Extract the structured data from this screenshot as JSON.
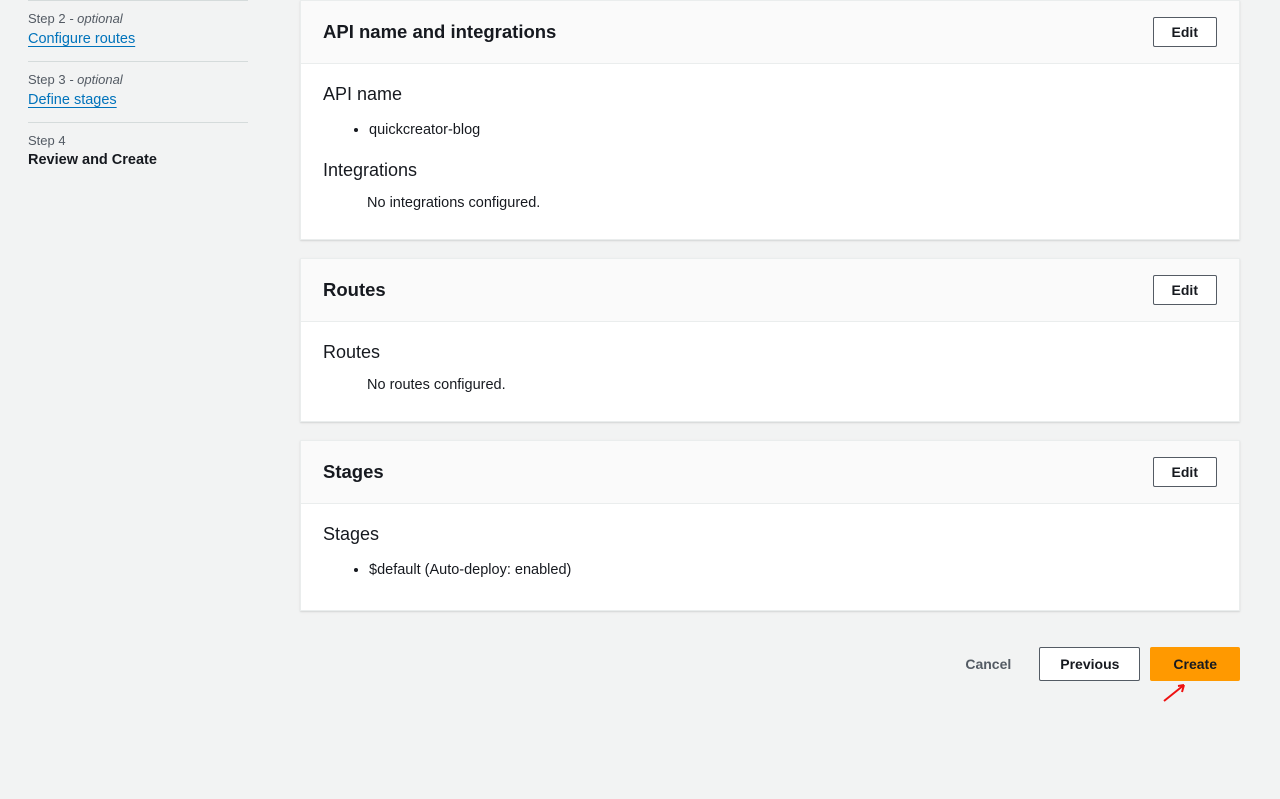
{
  "sidebar": {
    "steps": [
      {
        "meta": "Step 2",
        "optional": "- optional",
        "label": "Configure routes",
        "link": true
      },
      {
        "meta": "Step 3",
        "optional": "- optional",
        "label": "Define stages",
        "link": true
      },
      {
        "meta": "Step 4",
        "optional": "",
        "label": "Review and Create",
        "link": false
      }
    ]
  },
  "cards": {
    "api": {
      "title": "API name and integrations",
      "edit": "Edit",
      "name_heading": "API name",
      "name_value": "quickcreator-blog",
      "integrations_heading": "Integrations",
      "integrations_value": "No integrations configured."
    },
    "routes": {
      "title": "Routes",
      "edit": "Edit",
      "heading": "Routes",
      "value": "No routes configured."
    },
    "stages": {
      "title": "Stages",
      "edit": "Edit",
      "heading": "Stages",
      "value": "$default (Auto-deploy: enabled)"
    }
  },
  "actions": {
    "cancel": "Cancel",
    "previous": "Previous",
    "create": "Create"
  }
}
